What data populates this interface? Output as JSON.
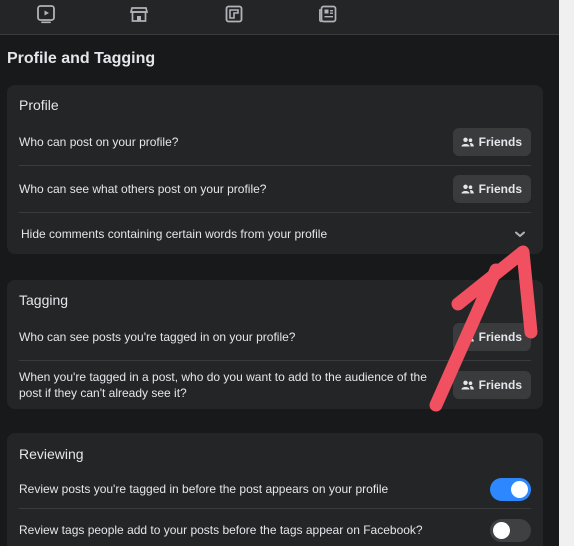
{
  "nav": {
    "icons": [
      "watch-icon",
      "marketplace-icon",
      "gaming-icon",
      "news-feed-icon"
    ]
  },
  "page_title": "Profile and Tagging",
  "profile_section": {
    "title": "Profile",
    "rows": [
      {
        "label": "Who can post on your profile?",
        "value": "Friends"
      },
      {
        "label": "Who can see what others post on your profile?",
        "value": "Friends"
      },
      {
        "label": "Hide comments containing certain words from your profile"
      }
    ]
  },
  "tagging_section": {
    "title": "Tagging",
    "rows": [
      {
        "label": "Who can see posts you're tagged in on your profile?",
        "value": "Friends"
      },
      {
        "label_line1": "When you're tagged in a post, who do you want to add to the audience of the",
        "label_line2": "post if they can't already see it?",
        "value": "Friends"
      }
    ]
  },
  "reviewing_section": {
    "title": "Reviewing",
    "rows": [
      {
        "label": "Review posts you're tagged in before the post appears on your profile",
        "enabled": true
      },
      {
        "label": "Review tags people add to your posts before the tags appear on Facebook?",
        "enabled": false
      }
    ]
  },
  "colors": {
    "background": "#18191a",
    "card": "#242526",
    "button": "#3a3b3c",
    "toggle_on": "#2d88ff",
    "annotation_arrow": "#f0505f"
  }
}
